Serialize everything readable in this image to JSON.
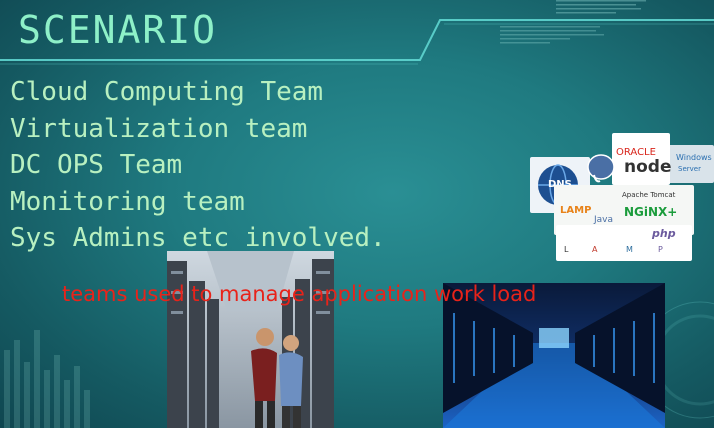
{
  "slide": {
    "title": "SCENARIO",
    "bullets": [
      "Cloud Computing Team",
      "Virtualization team",
      "DC OPS Team",
      "Monitoring team",
      "Sys Admins etc involved."
    ],
    "caption": "teams used to manage application work load"
  },
  "logos": {
    "oracle": "ORACLE",
    "node": "node",
    "windows": "Windows",
    "server": "Server",
    "dns": "DNS",
    "apache_tomcat": "Apache Tomcat",
    "nginx": "NGiNX+",
    "lamp": "LAMP",
    "java": "Java",
    "php": "php",
    "lamp_l": "L",
    "lamp_a": "A",
    "lamp_m": "M",
    "lamp_p": "P"
  },
  "colors": {
    "background": "#1f7a80",
    "title": "#8ef0c8",
    "bullet_text": "#b8f0c0",
    "caption": "#e8231a",
    "accent_line": "#5fd6d0"
  }
}
